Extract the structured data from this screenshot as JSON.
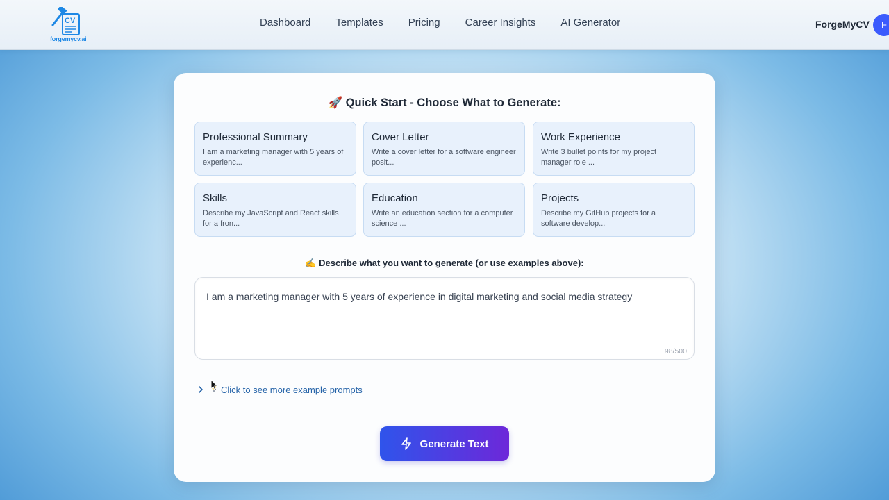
{
  "header": {
    "logo_text": "forgemycv.ai",
    "logo_badge": "CV",
    "nav": [
      "Dashboard",
      "Templates",
      "Pricing",
      "Career Insights",
      "AI Generator"
    ],
    "user_name": "ForgeMyCV",
    "avatar_initial": "F"
  },
  "main": {
    "quick_title": "🚀 Quick Start - Choose What to Generate:",
    "tiles": [
      {
        "title": "Professional Summary",
        "desc": "I am a marketing manager with 5 years of experienc..."
      },
      {
        "title": "Cover Letter",
        "desc": "Write a cover letter for a software engineer posit..."
      },
      {
        "title": "Work Experience",
        "desc": "Write 3 bullet points for my project manager role ..."
      },
      {
        "title": "Skills",
        "desc": "Describe my JavaScript and React skills for a fron..."
      },
      {
        "title": "Education",
        "desc": "Write an education section for a computer science ..."
      },
      {
        "title": "Projects",
        "desc": "Describe my GitHub projects for a software develop..."
      }
    ],
    "describe_label": "✍️ Describe what you want to generate (or use examples above):",
    "prompt_value": "I am a marketing manager with 5 years of experience in digital marketing and social media strategy",
    "char_count": "98/500",
    "examples_toggle": "Click to see more example prompts",
    "generate_label": "Generate Text"
  },
  "icons": {
    "logo": "cv-hammer-logo",
    "examples_chevron": "chevron-right-icon",
    "examples_bulb": "lightbulb-icon",
    "generate": "lightning-icon"
  },
  "colors": {
    "accent_start": "#2f54eb",
    "accent_end": "#6d28d9",
    "brand": "#1e88e5",
    "tile_bg": "#e8f1fc",
    "link": "#2563a8"
  }
}
